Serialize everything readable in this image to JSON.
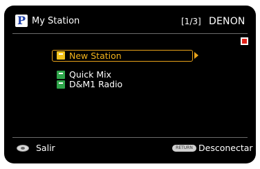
{
  "header": {
    "logo_letter": "P",
    "title": "My Station",
    "page_indicator": "[1/3]",
    "brand": "DENON"
  },
  "list": {
    "items": [
      {
        "label": "New Station",
        "selected": true
      },
      {
        "label": "Quick Mix",
        "selected": false
      },
      {
        "label": "D&M1 Radio",
        "selected": false
      }
    ]
  },
  "footer": {
    "left_label": "Salir",
    "return_button": "RETURN",
    "right_label": "Desconectar"
  },
  "colors": {
    "background": "#000000",
    "selection": "#e8a21a",
    "folder_icon": "#2fa54a",
    "stop_indicator": "#e2231a"
  }
}
